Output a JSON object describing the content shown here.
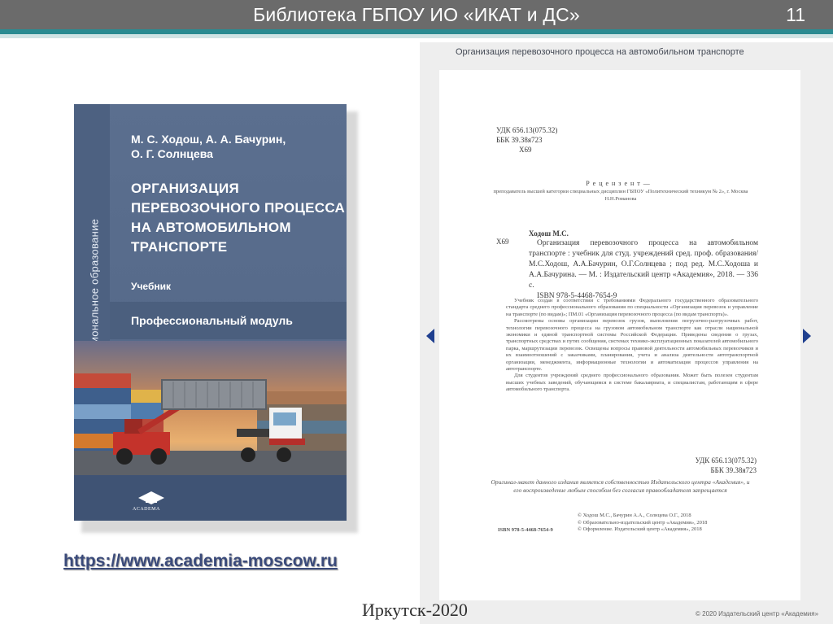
{
  "header": {
    "title": "Библиотека ГБПОУ ИО «ИКАТ и ДС»",
    "slide_number": "11"
  },
  "book_cover": {
    "series": "Профессиональное образование",
    "authors_line1": "М. С. Ходош, А. А. Бачурин,",
    "authors_line2": "О. Г. Солнцева",
    "title_line1": "ОРГАНИЗАЦИЯ",
    "title_line2": "ПЕРЕВОЗОЧНОГО ПРОЦЕССА",
    "title_line3": "НА АВТОМОБИЛЬНОМ ТРАНСПОРТЕ",
    "type": "Учебник",
    "module": "Профессиональный модуль",
    "publisher": "ACADEMA"
  },
  "link": {
    "text": "https://www.academia-moscow.ru"
  },
  "footer": {
    "city": "Иркутск-2020"
  },
  "document": {
    "header": "Организация перевозочного процесса на автомобильном транспорте",
    "udk_line1": "УДК  656.13(075.32)",
    "udk_line2": "ББК  39.38я723",
    "udk_line3": "Х69",
    "reviewer_title": "Р е ц е н з е н т —",
    "reviewer_body": "преподаватель высшей категории специальных дисциплин ГБПОУ «Политехнический техникум № 2», г. Москва Н.Н.Романова",
    "code": "Х69",
    "author": "Ходош М.С.",
    "biblio": "Организация перевозочного процесса на автомобильном транспорте : учебник для студ. учреждений сред. проф. образования/М.С.Ходош, А.А.Бачурин, О.Г.Солнцева ; под ред. М.С.Ходоша и А.А.Бачурина. — М. : Издательский центр «Академия», 2018. — 336 с.",
    "isbn": "ISBN 978-5-4468-7654-9",
    "abstract1": "Учебник создан в соответствии с требованиями Федерального государственного образовательного стандарта среднего профессионального образования по специальности «Организация перевозок и управление на транспорте (по видам)»; ПМ.01 «Организация перевозочного процесса (по видам транспорта)».",
    "abstract2": "Рассмотрены основы организации перевозок грузов, выполнения погрузочно-разгрузочных работ, технологии перевозочного процесса на грузовом автомобильном транспорте как отрасли национальной экономики и единой транспортной системы Российской Федерации. Приведены сведения о грузах, транспортных средствах и путях сообщения, системах технико-эксплуатационных показателей автомобильного парка, маршрутизации перевозок. Освещены вопросы правовой деятельности автомобильных перевозчиков и их взаимоотношений с заказчиками, планирования, учета и анализа деятельности автотранспортной организации, менеджмента, информационные технологии и автоматизация процессов управления на автотранспорте.",
    "abstract3": "Для студентов учреждений среднего профессионального образования. Может быть полезен студентам высших учебных заведений, обучающимся в системе бакалавриата, и специалистам, работающим в сфере автомобильного транспорта.",
    "udk2": "УДК 656.13(075.32)",
    "bbk2": "ББК 39.38я723",
    "notice": "Оригинал-макет данного издания является собственностью Издательского центра «Академия», и его воспроизведение любым способом без согласия правообладателя запрещается",
    "copyright1": "© Ходош М.С., Бачурин А.А., Солнцева О.Г., 2018",
    "copyright2": "© Образовательно-издательский центр «Академия», 2018",
    "copyright3": "© Оформление. Издательский центр «Академия», 2018",
    "isbn_bottom": "ISBN 978-5-4468-7654-9",
    "page_copyright": "© 2020 Издательский центр «Академия»"
  },
  "colors": {
    "header_bg": "#6b6b6b",
    "header_accent": "#2a8b91",
    "cover_blue": "#566a8a",
    "link_color": "#3a4a7a",
    "arrow_color": "#1f3f8f"
  }
}
